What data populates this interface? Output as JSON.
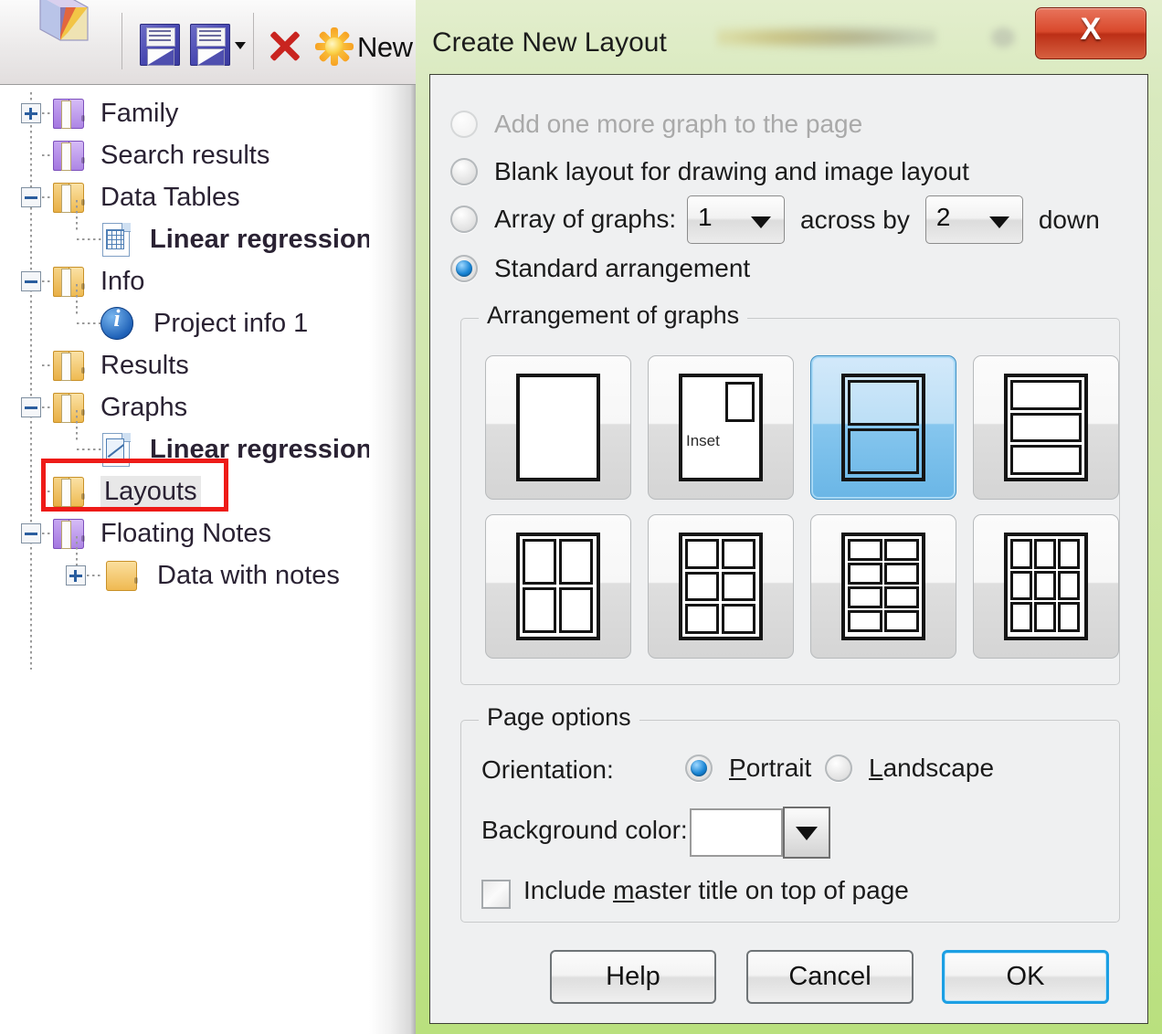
{
  "app": {
    "toolbar": {
      "logo_icon": "prism-cube-logo",
      "save_icon": "save-floppy-icon",
      "save_as_icon": "save-as-floppy-icon",
      "delete_icon": "delete-x-icon",
      "new_icon": "new-sunburst-icon",
      "new_label": "New"
    },
    "tree": {
      "items": [
        {
          "label": "Family",
          "icon": "folder-purple-icon",
          "indent": 0,
          "toggle": "plus",
          "bold": false,
          "selected": false
        },
        {
          "label": "Search results",
          "icon": "folder-purple-icon",
          "indent": 0,
          "toggle": "none",
          "bold": false,
          "selected": false
        },
        {
          "label": "Data Tables",
          "icon": "folder-yellow-icon",
          "indent": 0,
          "toggle": "minus",
          "bold": false,
          "selected": false
        },
        {
          "label": "Linear regression",
          "icon": "data-table-icon",
          "indent": 1,
          "toggle": "none",
          "bold": true,
          "selected": false
        },
        {
          "label": "Info",
          "icon": "folder-yellow-icon",
          "indent": 0,
          "toggle": "minus",
          "bold": false,
          "selected": false
        },
        {
          "label": "Project info 1",
          "icon": "info-circle-icon",
          "indent": 1,
          "toggle": "none",
          "bold": false,
          "selected": false
        },
        {
          "label": "Results",
          "icon": "folder-yellow-icon",
          "indent": 0,
          "toggle": "none",
          "bold": false,
          "selected": false
        },
        {
          "label": "Graphs",
          "icon": "folder-yellow-icon",
          "indent": 0,
          "toggle": "minus",
          "bold": false,
          "selected": false
        },
        {
          "label": "Linear regression",
          "icon": "graph-icon",
          "indent": 1,
          "toggle": "none",
          "bold": true,
          "selected": false
        },
        {
          "label": "Layouts",
          "icon": "folder-yellow-icon",
          "indent": 0,
          "toggle": "none",
          "bold": false,
          "selected": true
        },
        {
          "label": "Floating Notes",
          "icon": "folder-purple-icon",
          "indent": 0,
          "toggle": "minus",
          "bold": false,
          "selected": false
        },
        {
          "label": "Data with notes",
          "icon": "folder-plain-icon",
          "indent": 1,
          "toggle": "plus",
          "bold": false,
          "selected": false
        }
      ],
      "highlight_color": "#ee1b18",
      "highlighted_item": "Layouts"
    }
  },
  "dialog": {
    "title": "Create New Layout",
    "close_label": "X",
    "accent_color": "#1c9fe3",
    "titlebar_color": "#cfe6a9",
    "options": [
      {
        "label": "Add one more graph to the page",
        "selected": false,
        "disabled": true
      },
      {
        "label": "Blank layout for drawing and image layout",
        "selected": false,
        "disabled": false
      },
      {
        "label": "Array of graphs:",
        "selected": false,
        "disabled": false
      },
      {
        "label": "Standard arrangement",
        "selected": true,
        "disabled": false
      }
    ],
    "array_row": {
      "across_value": "1",
      "across_by_label": "across by",
      "down_value": "2",
      "down_label": "down"
    },
    "arrangement": {
      "caption": "Arrangement of graphs",
      "selected_index": 2,
      "thumbs": [
        {
          "name": "single-graph",
          "rows": 1,
          "cols": 1,
          "inset": false
        },
        {
          "name": "graph-with-inset",
          "rows": 1,
          "cols": 1,
          "inset": true,
          "inset_label": "Inset"
        },
        {
          "name": "two-rows",
          "rows": 2,
          "cols": 1,
          "inset": false
        },
        {
          "name": "three-rows",
          "rows": 3,
          "cols": 1,
          "inset": false
        },
        {
          "name": "two-by-two",
          "rows": 2,
          "cols": 2,
          "inset": false
        },
        {
          "name": "three-by-two",
          "rows": 3,
          "cols": 2,
          "inset": false
        },
        {
          "name": "four-by-two",
          "rows": 4,
          "cols": 2,
          "inset": false
        },
        {
          "name": "three-by-three",
          "rows": 3,
          "cols": 3,
          "inset": false
        }
      ]
    },
    "page_options": {
      "caption": "Page options",
      "orientation_label": "Orientation:",
      "orientation": [
        {
          "label": "Portrait",
          "selected": true
        },
        {
          "label": "Landscape",
          "selected": false
        }
      ],
      "background_label": "Background color:",
      "background_value": "#ffffff",
      "master_title_label": "Include master title on top of page",
      "master_title_checked": false
    },
    "buttons": {
      "help": "Help",
      "cancel": "Cancel",
      "ok": "OK"
    }
  }
}
